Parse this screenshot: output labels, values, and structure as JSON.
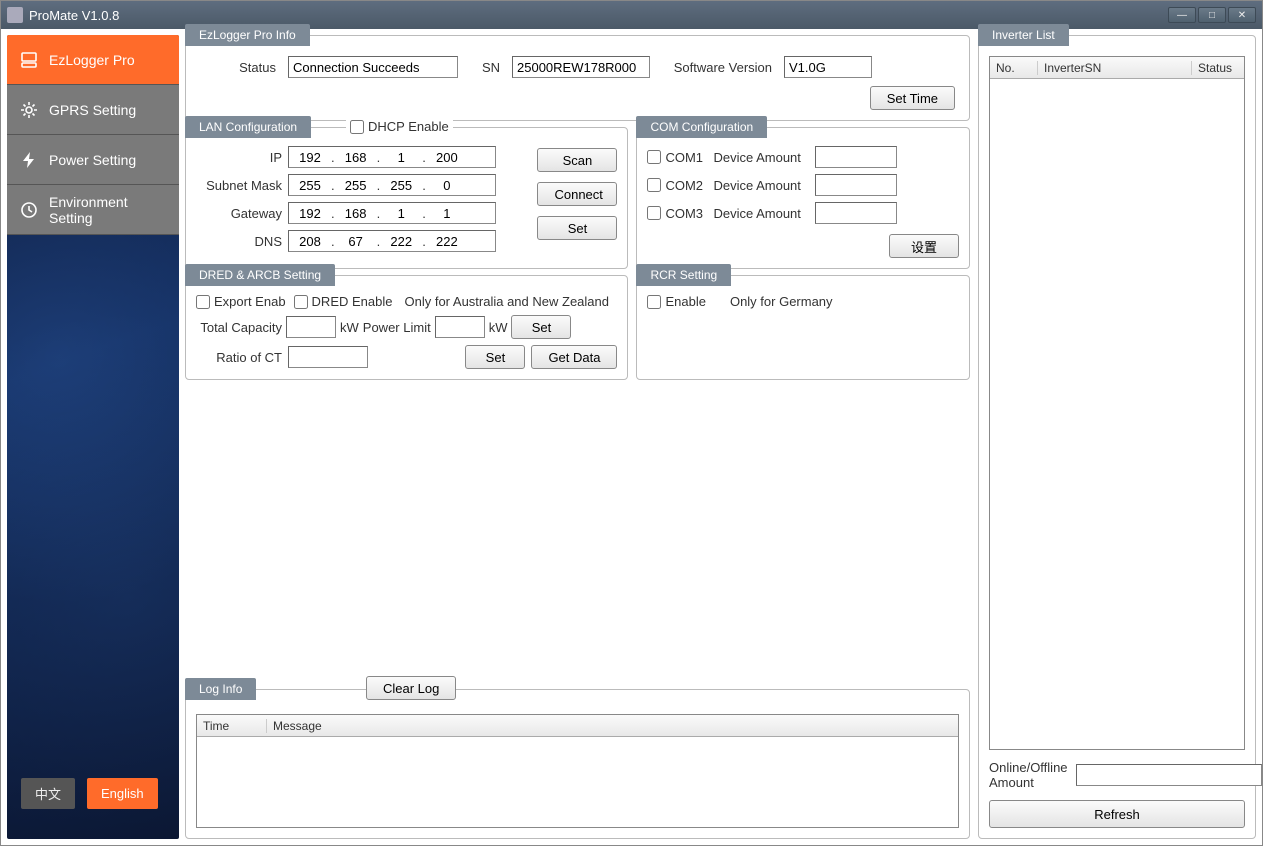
{
  "window": {
    "title": "ProMate V1.0.8"
  },
  "sidebar": {
    "items": [
      {
        "label": "EzLogger Pro"
      },
      {
        "label": "GPRS Setting"
      },
      {
        "label": "Power Setting"
      },
      {
        "label": "Environment Setting"
      }
    ],
    "lang_cn": "中文",
    "lang_en": "English"
  },
  "info": {
    "legend": "EzLogger Pro Info",
    "status_label": "Status",
    "status_value": "Connection Succeeds",
    "sn_label": "SN",
    "sn_value": "25000REW178R000",
    "sw_label": "Software Version",
    "sw_value": "V1.0G",
    "set_time": "Set Time"
  },
  "lan": {
    "legend": "LAN Configuration",
    "dhcp": "DHCP Enable",
    "ip_label": "IP",
    "ip": [
      "192",
      "168",
      "1",
      "200"
    ],
    "subnet_label": "Subnet Mask",
    "subnet": [
      "255",
      "255",
      "255",
      "0"
    ],
    "gateway_label": "Gateway",
    "gateway": [
      "192",
      "168",
      "1",
      "1"
    ],
    "dns_label": "DNS",
    "dns": [
      "208",
      "67",
      "222",
      "222"
    ],
    "scan": "Scan",
    "connect": "Connect",
    "set": "Set"
  },
  "com": {
    "legend": "COM Configuration",
    "com1": "COM1",
    "com2": "COM2",
    "com3": "COM3",
    "amount_label": "Device Amount",
    "set": "设置"
  },
  "dred": {
    "legend": "DRED & ARCB Setting",
    "export_enab": "Export Enab",
    "dred_enable": "DRED Enable",
    "note": "Only for Australia and New Zealand",
    "total_capacity": "Total Capacity",
    "kw": "kW",
    "power_limit": "Power Limit",
    "ratio": "Ratio of CT",
    "set": "Set",
    "get_data": "Get Data"
  },
  "rcr": {
    "legend": "RCR Setting",
    "enable": "Enable",
    "note": "Only for Germany"
  },
  "log": {
    "legend": "Log Info",
    "clear": "Clear Log",
    "col_time": "Time",
    "col_message": "Message"
  },
  "inverter": {
    "legend": "Inverter List",
    "col_no": "No.",
    "col_sn": "InverterSN",
    "col_status": "Status",
    "online_label": "Online/Offline Amount",
    "refresh": "Refresh"
  }
}
